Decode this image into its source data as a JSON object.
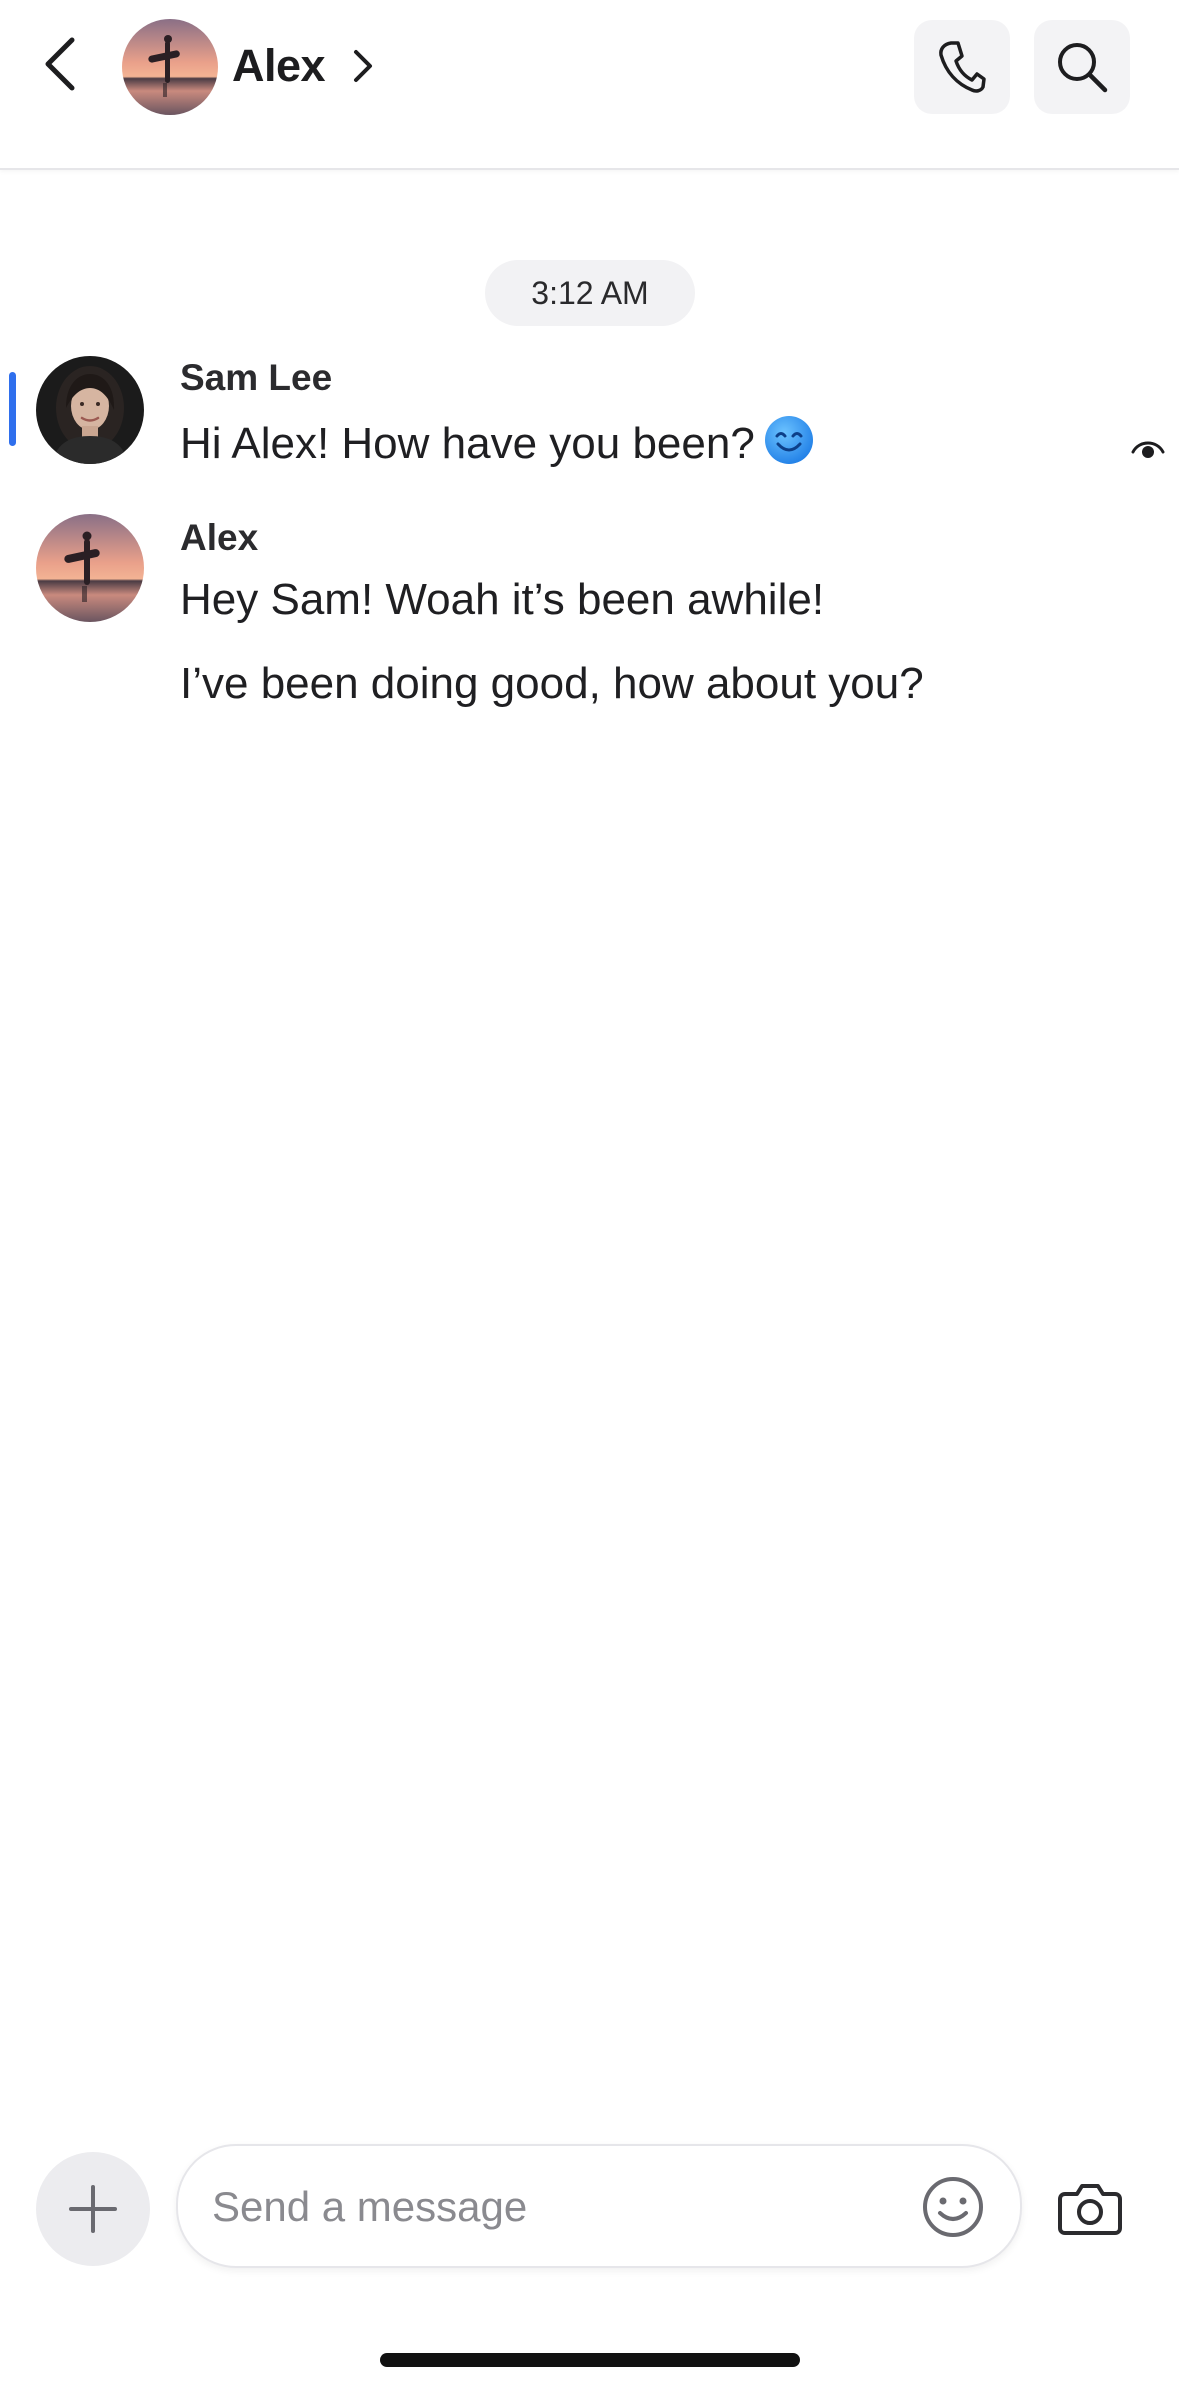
{
  "header": {
    "contact_name": "Alex",
    "back_icon": "chevron-left-icon",
    "chevron_icon": "chevron-right-icon",
    "call_icon": "phone-icon",
    "search_icon": "search-icon"
  },
  "conversation": {
    "timestamp": "3:12 AM",
    "messages": [
      {
        "sender": "Sam Lee",
        "texts": [
          "Hi Alex! How have you been?"
        ],
        "emoji": "smiling-face-icon",
        "unread_indicator": true,
        "seen_icon": "eye-icon"
      },
      {
        "sender": "Alex",
        "texts": [
          "Hey Sam! Woah it’s been awhile!",
          "I’ve been doing good, how about you?"
        ]
      }
    ]
  },
  "composer": {
    "placeholder": "Send a message",
    "value": "",
    "add_icon": "plus-icon",
    "emoji_icon": "smiley-icon",
    "camera_icon": "camera-icon"
  },
  "colors": {
    "accent": "#2f6fed",
    "pill_background": "#f2f2f4",
    "header_button_background": "#f3f3f5"
  }
}
